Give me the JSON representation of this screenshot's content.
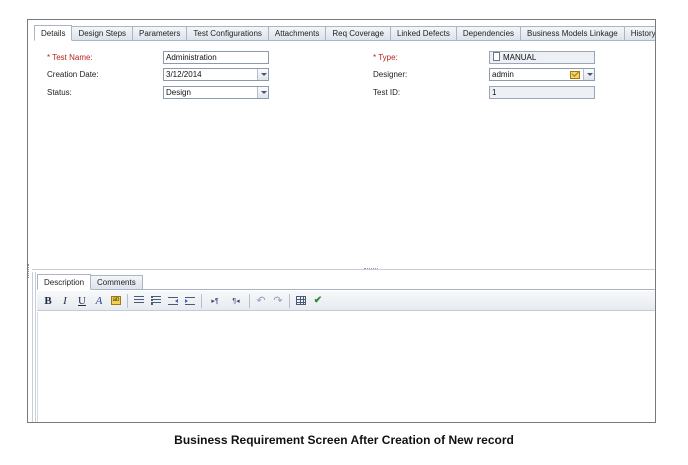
{
  "tabs": [
    {
      "label": "Details",
      "active": true
    },
    {
      "label": "Design Steps",
      "active": false
    },
    {
      "label": "Parameters",
      "active": false
    },
    {
      "label": "Test Configurations",
      "active": false
    },
    {
      "label": "Attachments",
      "active": false
    },
    {
      "label": "Req Coverage",
      "active": false
    },
    {
      "label": "Linked Defects",
      "active": false
    },
    {
      "label": "Dependencies",
      "active": false
    },
    {
      "label": "Business Models Linkage",
      "active": false
    },
    {
      "label": "History",
      "active": false
    }
  ],
  "form": {
    "test_name_label": "* Test Name:",
    "test_name_value": "Administration",
    "creation_date_label": "Creation Date:",
    "creation_date_value": "3/12/2014",
    "status_label": "Status:",
    "status_value": "Design",
    "type_label": "* Type:",
    "type_value": "MANUAL",
    "designer_label": "Designer:",
    "designer_value": "admin",
    "test_id_label": "Test ID:",
    "test_id_value": "1"
  },
  "bottom_tabs": [
    {
      "label": "Description",
      "active": true
    },
    {
      "label": "Comments",
      "active": false
    }
  ],
  "toolbar": {
    "bold": "B",
    "italic": "I",
    "underline": "U",
    "font_color": "A",
    "highlight": "ab",
    "ltr": "▸¶",
    "rtl": "¶◂",
    "undo": "↶",
    "redo": "↷",
    "spell": "✔"
  },
  "caption": "Business Requirement Screen After Creation of New record",
  "colors": {
    "required_label": "#b3261e",
    "field_border": "#8c9ab0",
    "tab_border": "#a9b4c4"
  }
}
